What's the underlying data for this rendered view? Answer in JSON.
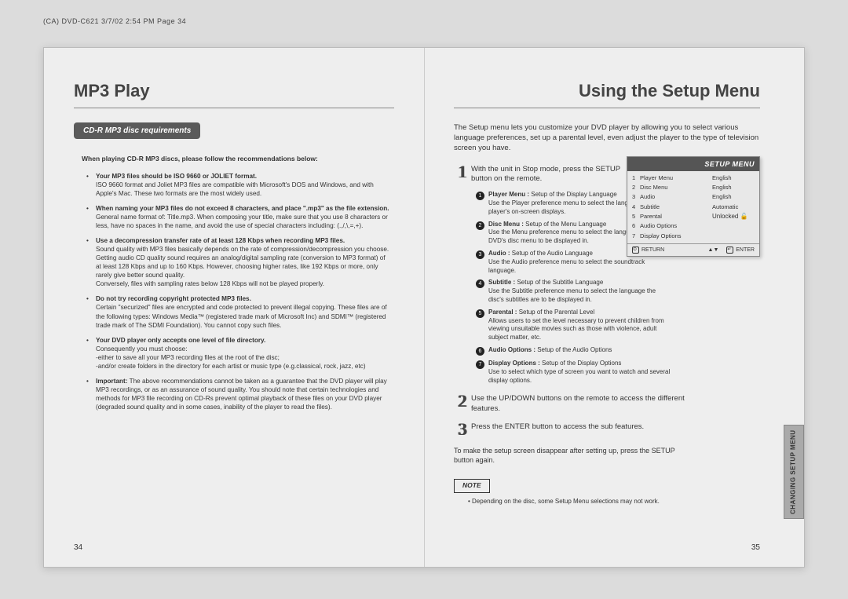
{
  "header_line": "(CA) DVD-C621 3/7/02 2:54 PM Page 34",
  "left": {
    "title": "MP3 Play",
    "pill": "CD-R MP3 disc requirements",
    "lead": "When playing CD-R MP3 discs, please follow the recommendations below:",
    "bullets": [
      {
        "b": "Your MP3 files should be ISO 9660 or JOLIET format.",
        "t": "ISO 9660 format and Joliet MP3 files are compatible with Microsoft's DOS and Windows, and with Apple's Mac. These two formats are the most widely used."
      },
      {
        "b": "When naming your MP3 files do not exceed 8 characters, and place \".mp3\" as the file extension.",
        "t": "General name format of: Title.mp3. When composing your title, make sure that you use 8 characters or less, have no spaces in the name, and avoid the use of special characters including: (.,/,\\,=,+)."
      },
      {
        "b": "Use a decompression transfer rate of at least 128 Kbps when recording MP3 files.",
        "t": "Sound quality with MP3 files basically depends on the rate of compression/decompression you choose. Getting audio CD quality sound requires an analog/digital sampling rate (conversion to MP3 format) of at least 128 Kbps and up to 160 Kbps. However, choosing higher rates, like 192 Kbps or more, only rarely give better sound quality.\nConversely, files with sampling rates below 128 Kbps will not be played properly."
      },
      {
        "b": "Do not try recording copyright protected MP3 files.",
        "t": "Certain \"securized\" files are encrypted and code protected to prevent illegal copying. These files are of the following types: Windows Media™ (registered trade mark of Microsoft Inc) and SDMI™ (registered trade mark of The SDMI Foundation). You cannot copy such files."
      },
      {
        "b": "Your DVD player only accepts one level of file directory.",
        "t": "Consequently you must choose:\n-either to save all your MP3 recording files at the root of the disc;\n-and/or create folders in the directory for each artist or music type (e.g.classical, rock, jazz, etc)"
      },
      {
        "b": "Important:",
        "t": "The above recommendations cannot be taken as a guarantee that the DVD player will play MP3 recordings, or as an assurance of sound quality.\nYou should note that certain technologies and methods for MP3 file recording on CD-Rs prevent optimal playback of these files on your DVD player (degraded sound quality and in some cases, inability of the player to read the files)."
      }
    ],
    "page_num": "34"
  },
  "right": {
    "title": "Using the Setup Menu",
    "intro": "The Setup menu lets you customize your DVD player by allowing you to select various language preferences, set up a parental level, even adjust the player to the type of television screen you have.",
    "steps": [
      {
        "n": "1",
        "txt": "With the unit in Stop mode, press the SETUP button on the remote."
      },
      {
        "n": "2",
        "txt": "Use the UP/DOWN buttons on the remote to access the different features."
      },
      {
        "n": "3",
        "txt": "Press the ENTER button to access the sub features."
      }
    ],
    "sub_items": [
      {
        "n": "1",
        "h": "Player Menu :",
        "t": " Setup of the Display Language\nUse the Player preference menu to select the language for the player's on-screen displays."
      },
      {
        "n": "2",
        "h": "Disc Menu :",
        "t": " Setup of the Menu Language\nUse the Menu preference menu to select the language you want a DVD's disc menu to be displayed in."
      },
      {
        "n": "3",
        "h": "Audio :",
        "t": " Setup of the Audio Language\nUse the Audio preference menu to select the soundtrack language."
      },
      {
        "n": "4",
        "h": "Subtitle :",
        "t": " Setup of the Subtitle Language\nUse the Subtitle preference menu to select the language the disc's subtitles are to be displayed in."
      },
      {
        "n": "5",
        "h": "Parental :",
        "t": " Setup of the Parental Level\nAllows users to set the level necessary to prevent children from viewing unsuitable movies such as those with violence, adult subject matter, etc."
      },
      {
        "n": "6",
        "h": "Audio Options :",
        "t": " Setup of the Audio Options"
      },
      {
        "n": "7",
        "h": "Display Options :",
        "t": " Setup of the Display Options\nUse to select which type of screen you want to watch and several display options."
      }
    ],
    "closing": "To make the setup screen disappear after setting up, press the SETUP button again.",
    "note_label": "NOTE",
    "note_text": "Depending on the disc, some Setup Menu selections may not work.",
    "page_num": "35",
    "sidebar": "CHANGING SETUP MENU",
    "setup_box": {
      "title": "SETUP MENU",
      "rows": [
        {
          "n": "1",
          "l": "Player Menu",
          "v": "English"
        },
        {
          "n": "2",
          "l": "Disc Menu",
          "v": "English"
        },
        {
          "n": "3",
          "l": "Audio",
          "v": "English"
        },
        {
          "n": "4",
          "l": "Subtitle",
          "v": "Automatic"
        },
        {
          "n": "5",
          "l": "Parental",
          "v": "Unlocked 🔓"
        },
        {
          "n": "6",
          "l": "Audio Options",
          "v": ""
        },
        {
          "n": "7",
          "l": "Display Options",
          "v": ""
        }
      ],
      "ftr_return": "RETURN",
      "ftr_enter": "ENTER"
    }
  }
}
